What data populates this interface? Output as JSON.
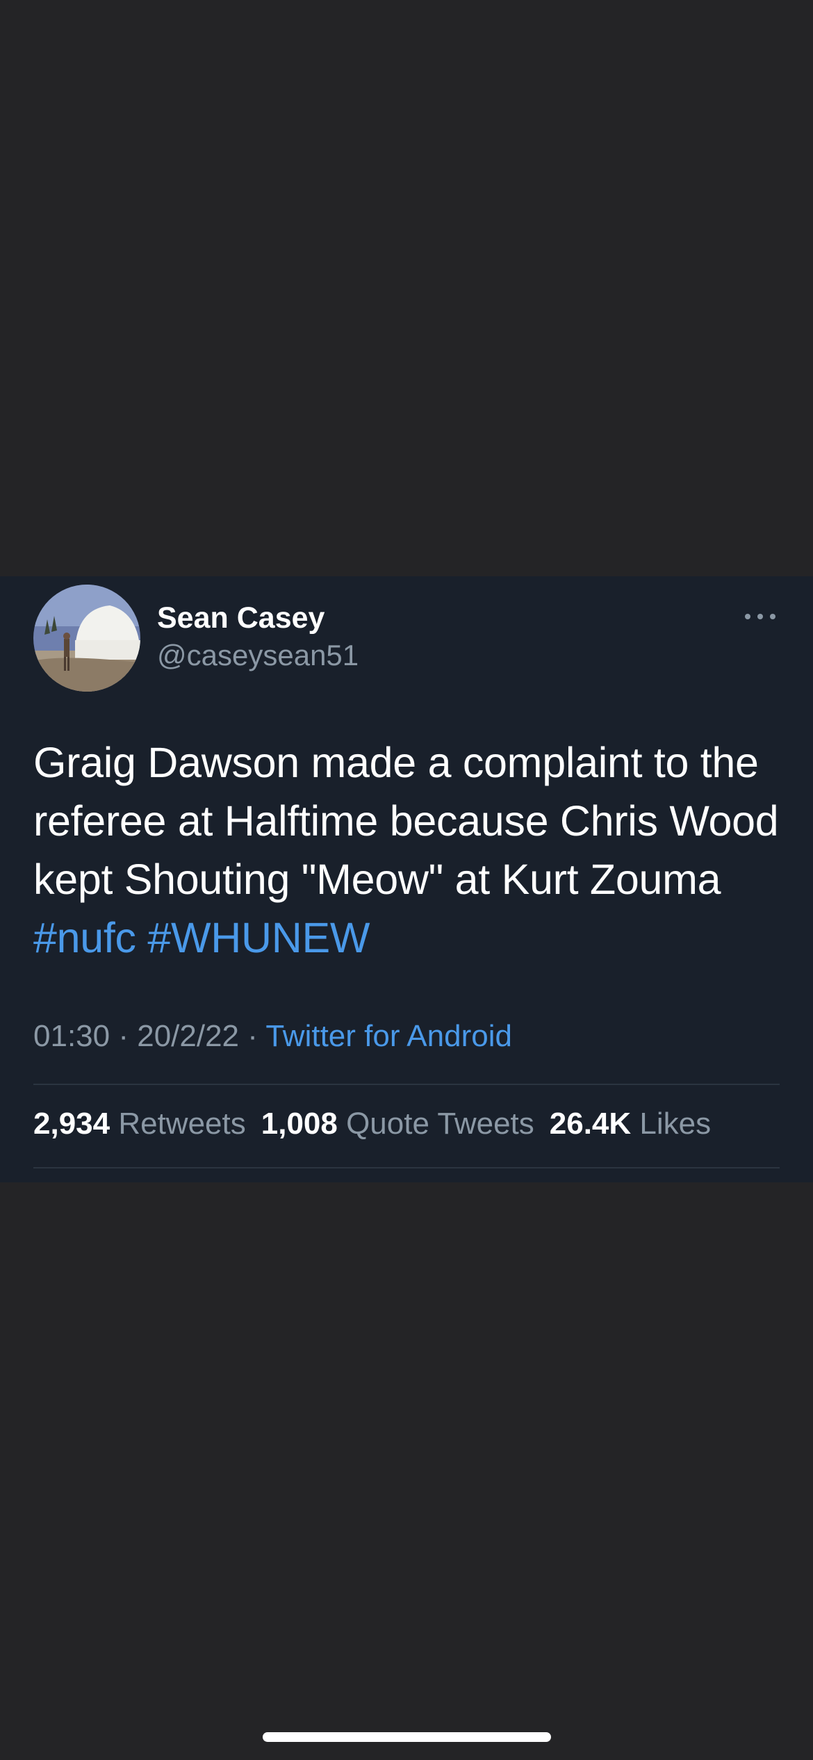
{
  "tweet": {
    "author": {
      "display_name": "Sean Casey",
      "handle": "@caseysean51"
    },
    "text_parts": [
      "Graig Dawson made a complaint to the referee at Halftime because Chris Wood kept Shouting \"Meow\" at Kurt Zouma ",
      "#nufc",
      " ",
      "#WHUNEW"
    ],
    "time": "01:30",
    "separator": " · ",
    "date": "20/2/22",
    "source": "Twitter for Android",
    "stats": {
      "retweets_count": "2,934",
      "retweets_label": " Retweets",
      "quotes_count": "1,008",
      "quotes_label": " Quote Tweets",
      "likes_count": "26.4K",
      "likes_label": " Likes"
    },
    "more_icon": "more-horizontal-icon"
  },
  "colors": {
    "page_background": "#242426",
    "card_background": "#19202b",
    "text_primary": "#ffffff",
    "text_secondary": "#8b98a5",
    "accent": "#4a99e9"
  }
}
